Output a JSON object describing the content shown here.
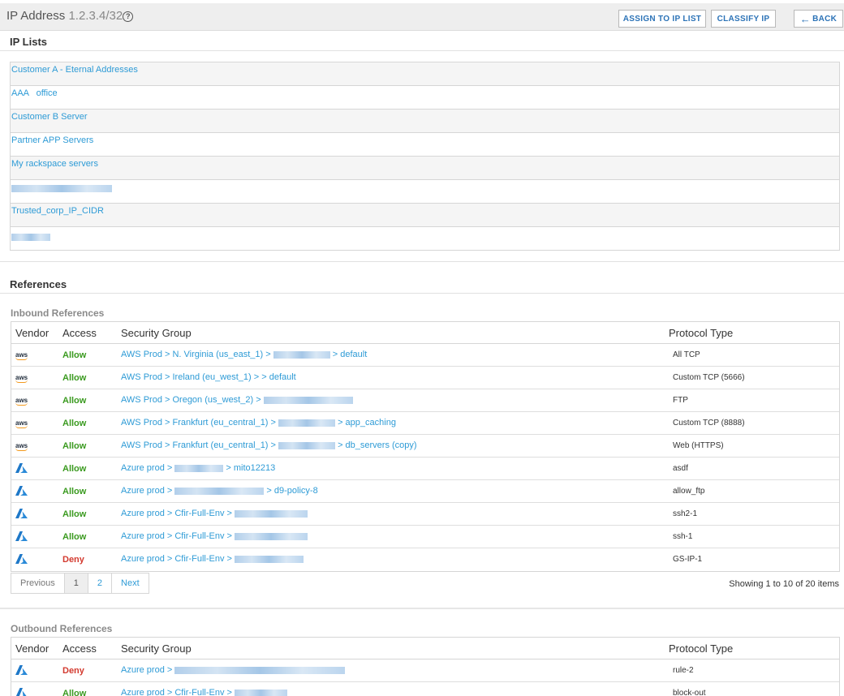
{
  "header": {
    "title_label": "IP Address",
    "ip": "1.2.3.4/32",
    "help_icon": "?",
    "assign_button": "ASSIGN TO IP LIST",
    "classify_button": "CLASSIFY IP",
    "back_button": "BACK",
    "back_icon": "←"
  },
  "ip_lists": {
    "title": "IP Lists",
    "items": [
      {
        "label": "Customer A - Eternal Addresses"
      },
      {
        "label": "AAA   office"
      },
      {
        "label": "Customer B Server"
      },
      {
        "label": "Partner APP Servers"
      },
      {
        "label": "My rackspace servers"
      },
      {
        "label": ""
      },
      {
        "label": "Trusted_corp_IP_CIDR"
      },
      {
        "label": ""
      }
    ]
  },
  "references": {
    "title": "References",
    "columns": {
      "vendor": "Vendor",
      "access": "Access",
      "security_group": "Security Group",
      "protocol": "Protocol Type"
    },
    "inbound": {
      "title": "Inbound References",
      "rows": [
        {
          "vendor": "aws",
          "access": "Allow",
          "sg_prefix": "AWS Prod > N. Virginia (us_east_1) > ",
          "sg_suffix": " > default",
          "protocol": "All TCP"
        },
        {
          "vendor": "aws",
          "access": "Allow",
          "sg_prefix": "AWS Prod > Ireland (eu_west_1) > > default",
          "sg_suffix": "",
          "protocol": "Custom TCP (5666)"
        },
        {
          "vendor": "aws",
          "access": "Allow",
          "sg_prefix": "AWS Prod > Oregon (us_west_2) > ",
          "sg_suffix": "",
          "protocol": "FTP"
        },
        {
          "vendor": "aws",
          "access": "Allow",
          "sg_prefix": "AWS Prod > Frankfurt (eu_central_1) > ",
          "sg_suffix": " > app_caching",
          "protocol": "Custom TCP (8888)"
        },
        {
          "vendor": "aws",
          "access": "Allow",
          "sg_prefix": "AWS Prod > Frankfurt (eu_central_1) > ",
          "sg_suffix": " > db_servers (copy)",
          "protocol": "Web (HTTPS)"
        },
        {
          "vendor": "azure",
          "access": "Allow",
          "sg_prefix": "Azure prod > ",
          "sg_suffix": " > mito12213",
          "protocol": "asdf"
        },
        {
          "vendor": "azure",
          "access": "Allow",
          "sg_prefix": "Azure prod > ",
          "sg_suffix": " > d9-policy-8",
          "protocol": "allow_ftp"
        },
        {
          "vendor": "azure",
          "access": "Allow",
          "sg_prefix": "Azure prod > Cfir-Full-Env > ",
          "sg_suffix": "",
          "protocol": "ssh2-1"
        },
        {
          "vendor": "azure",
          "access": "Allow",
          "sg_prefix": "Azure prod > Cfir-Full-Env > ",
          "sg_suffix": "",
          "protocol": "ssh-1"
        },
        {
          "vendor": "azure",
          "access": "Deny",
          "sg_prefix": "Azure prod > Cfir-Full-Env > ",
          "sg_suffix": "",
          "protocol": "GS-IP-1"
        }
      ],
      "pager": {
        "prev": "Previous",
        "pages": [
          "1",
          "2"
        ],
        "next": "Next"
      },
      "showing": "Showing 1 to 10 of 20 items"
    },
    "outbound": {
      "title": "Outbound References",
      "rows": [
        {
          "vendor": "azure",
          "access": "Deny",
          "sg_prefix": "Azure prod > ",
          "sg_suffix": "",
          "protocol": "rule-2"
        },
        {
          "vendor": "azure",
          "access": "Allow",
          "sg_prefix": "Azure prod > Cfir-Full-Env > ",
          "sg_suffix": "",
          "protocol": "block-out"
        }
      ]
    }
  },
  "colors": {
    "link": "#2e9bd6",
    "allow": "#3a9a1f",
    "deny": "#d33a2f"
  }
}
